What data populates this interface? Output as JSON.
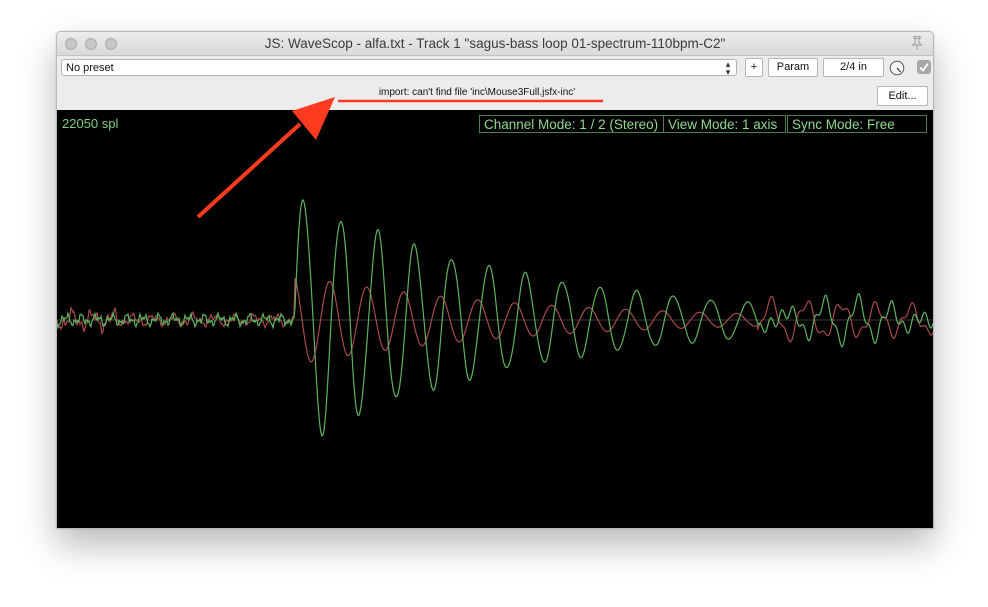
{
  "window": {
    "title": "JS: WaveScop - alfa.txt - Track 1 \"sagus-bass loop 01-spectrum-110bpm-C2\""
  },
  "toolbar": {
    "preset_value": "No preset",
    "add_label": "+",
    "param_label": "Param",
    "io_label": "2/4 in",
    "edit_label": "Edit...",
    "error_message": "import: can't find file 'inc\\Mouse3Full.jsfx-inc'"
  },
  "scope": {
    "sample_label": "22050 spl",
    "channel_mode": "Channel Mode:  1 / 2 (Stereo)",
    "view_mode": "View Mode: 1 axis",
    "sync_mode": "Sync Mode:  Free",
    "colors": {
      "background": "#000000",
      "channel1": "#a84a4a",
      "channel2": "#5fb35f",
      "text": "#8fd98f"
    }
  },
  "annotation": {
    "arrow_color": "#ff3b1f",
    "underline_color": "#ff3b1f"
  }
}
